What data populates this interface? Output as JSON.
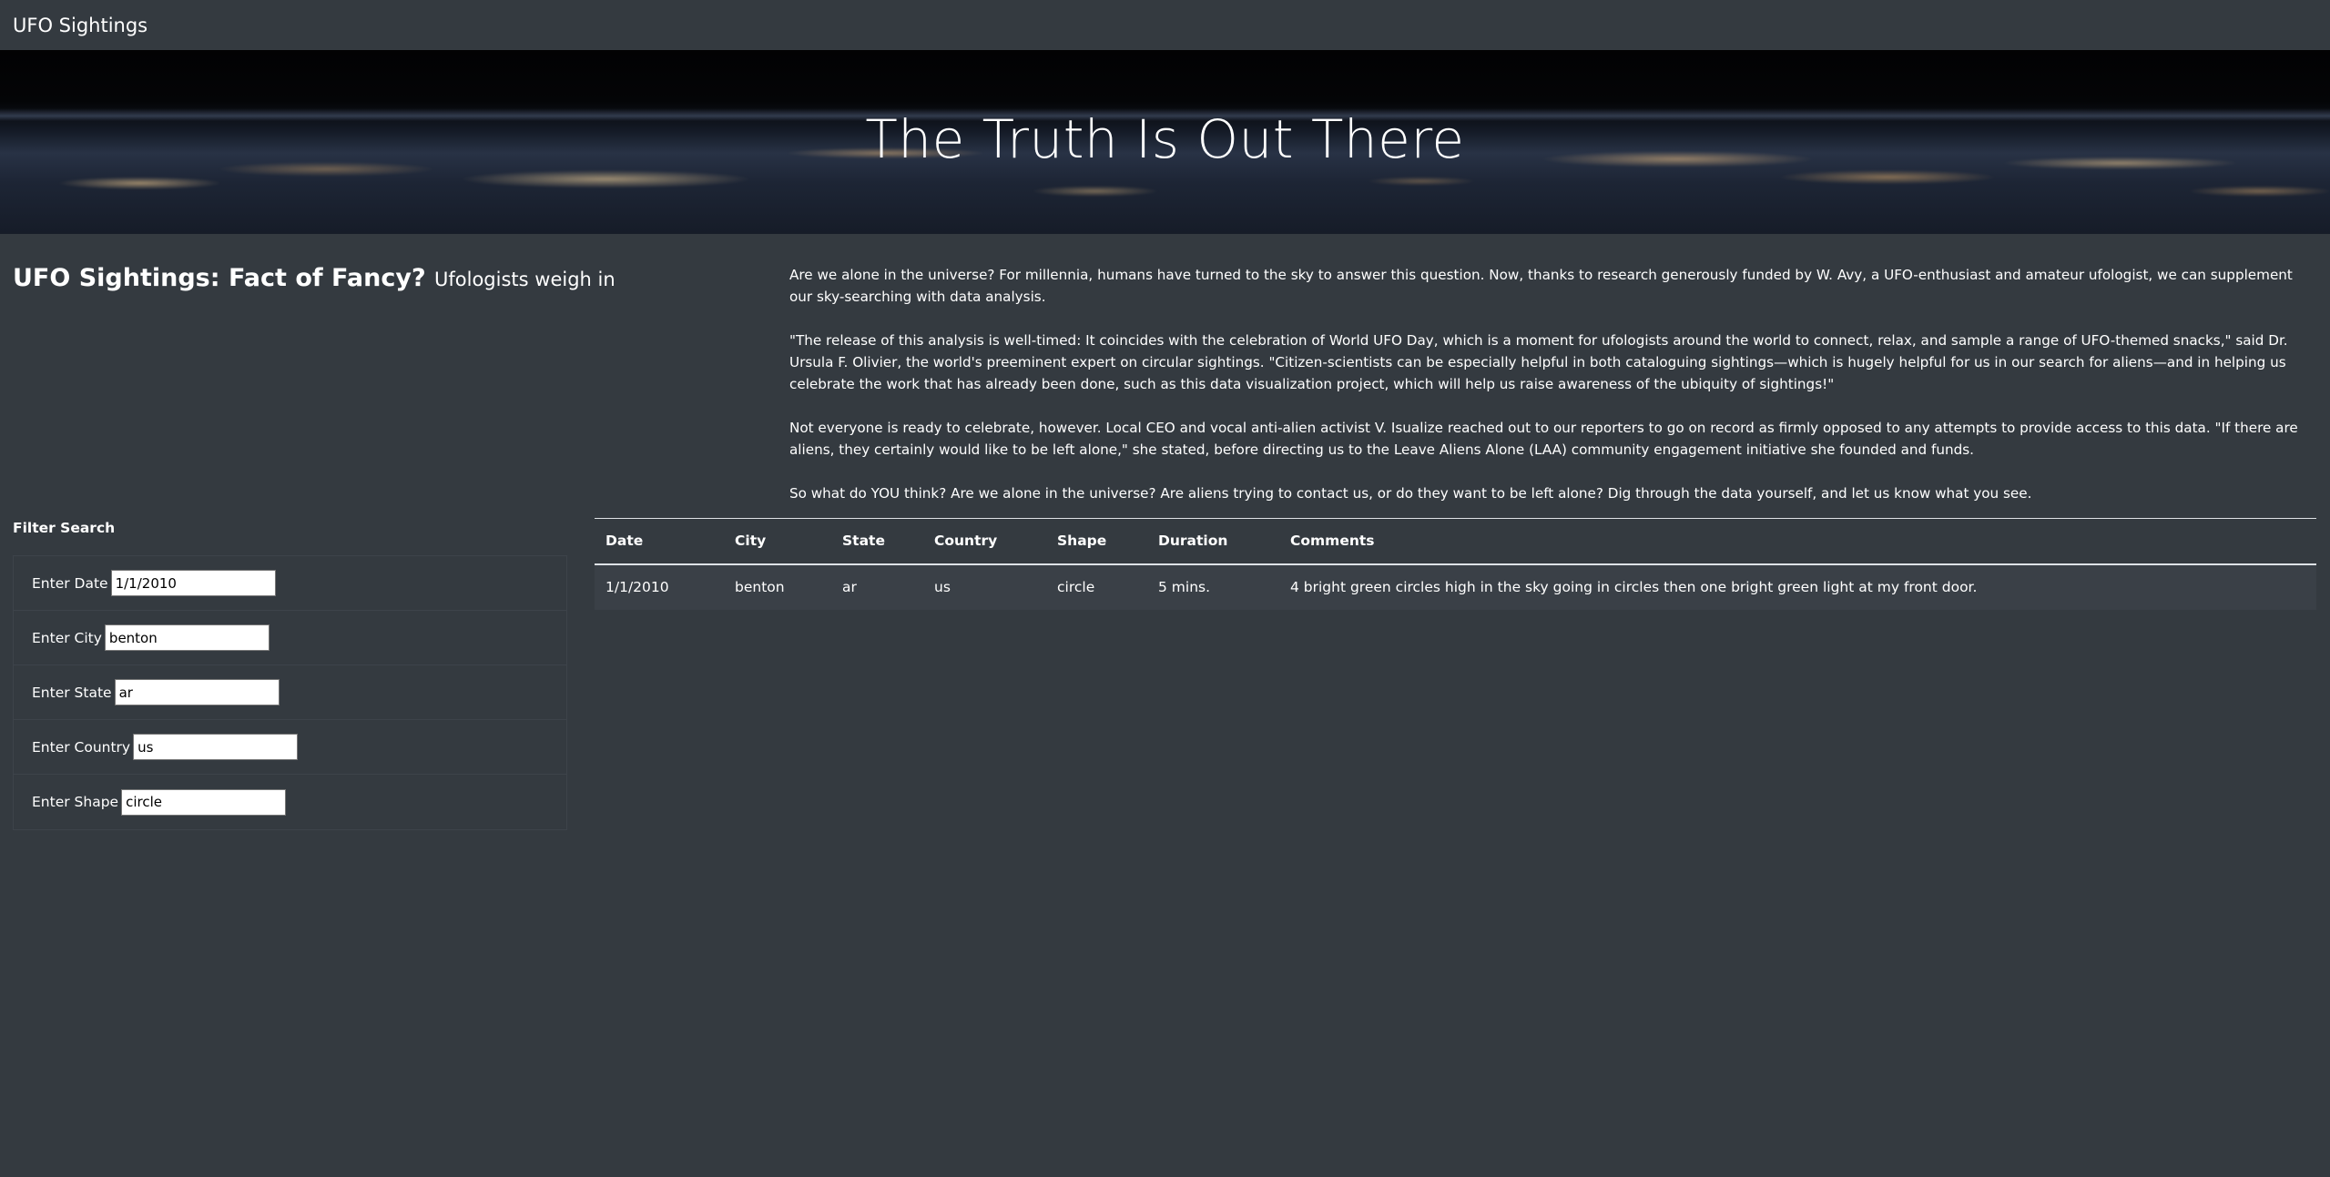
{
  "navbar": {
    "brand": "UFO Sightings"
  },
  "hero": {
    "title": "The Truth Is Out There"
  },
  "article": {
    "heading": "UFO Sightings: Fact of Fancy?",
    "subheading": "Ufologists weigh in",
    "paragraphs": [
      "Are we alone in the universe? For millennia, humans have turned to the sky to answer this question. Now, thanks to research generously funded by W. Avy, a UFO-enthusiast and amateur ufologist, we can supplement our sky-searching with data analysis.",
      "\"The release of this analysis is well-timed: It coincides with the celebration of World UFO Day, which is a moment for ufologists around the world to connect, relax, and sample a range of UFO-themed snacks,\" said Dr. Ursula F. Olivier, the world's preeminent expert on circular sightings. \"Citizen-scientists can be especially helpful in both cataloguing sightings—which is hugely helpful for us in our search for aliens—and in helping us celebrate the work that has already been done, such as this data visualization project, which will help us raise awareness of the ubiquity of sightings!\"",
      "Not everyone is ready to celebrate, however. Local CEO and vocal anti-alien activist V. Isualize reached out to our reporters to go on record as firmly opposed to any attempts to provide access to this data. \"If there are aliens, they certainly would like to be left alone,\" she stated, before directing us to the Leave Aliens Alone (LAA) community engagement initiative she founded and funds.",
      "So what do YOU think? Are we alone in the universe? Are aliens trying to contact us, or do they want to be left alone? Dig through the data yourself, and let us know what you see."
    ]
  },
  "filters": {
    "title": "Filter Search",
    "items": [
      {
        "label": "Enter Date",
        "value": "1/1/2010"
      },
      {
        "label": "Enter City",
        "value": "benton"
      },
      {
        "label": "Enter State",
        "value": "ar"
      },
      {
        "label": "Enter Country",
        "value": "us"
      },
      {
        "label": "Enter Shape",
        "value": "circle"
      }
    ]
  },
  "table": {
    "headers": [
      "Date",
      "City",
      "State",
      "Country",
      "Shape",
      "Duration",
      "Comments"
    ],
    "rows": [
      [
        "1/1/2010",
        "benton",
        "ar",
        "us",
        "circle",
        "5 mins.",
        "4 bright green circles high in the sky going in circles then one bright green light at my front door."
      ]
    ]
  }
}
